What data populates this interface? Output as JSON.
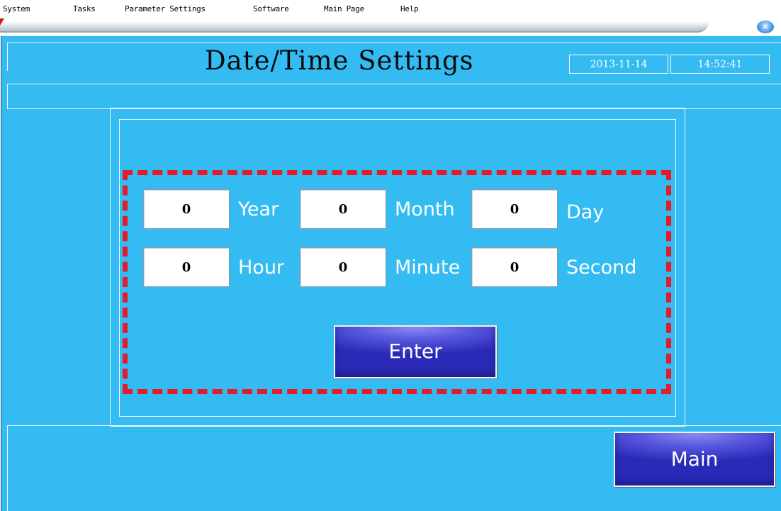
{
  "menu": {
    "items": [
      "System",
      "Tasks",
      "Parameter Settings",
      "Software",
      "Main Page",
      "Help"
    ]
  },
  "window": {
    "close_symbol": "×",
    "close_icon": "close-icon"
  },
  "header": {
    "title": "Date/Time Settings",
    "date": "2013-11-14",
    "time": "14:52:41"
  },
  "form": {
    "year": {
      "value": "0",
      "label": "Year"
    },
    "month": {
      "value": "0",
      "label": "Month"
    },
    "day": {
      "value": "0",
      "label": "Day"
    },
    "hour": {
      "value": "0",
      "label": "Hour"
    },
    "minute": {
      "value": "0",
      "label": "Minute"
    },
    "second": {
      "value": "0",
      "label": "Second"
    },
    "enter_label": "Enter"
  },
  "footer": {
    "main_label": "Main"
  },
  "colors": {
    "panel": "#33bbf2",
    "highlight_frame": "#e51a2a",
    "button": "#4040d0"
  }
}
